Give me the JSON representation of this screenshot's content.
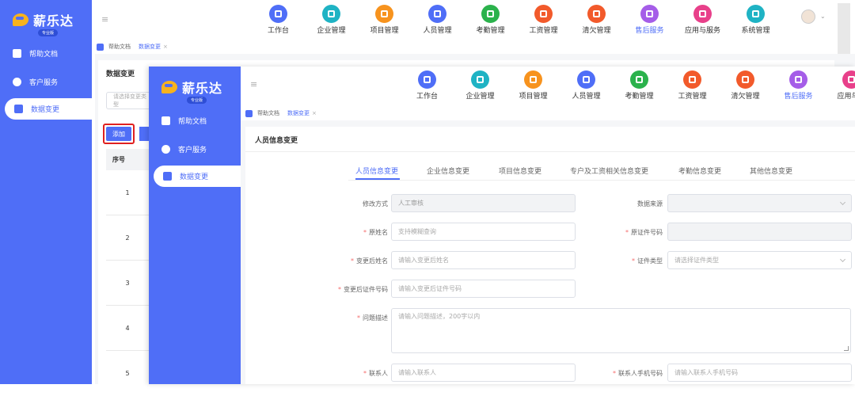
{
  "brand": {
    "name": "薪乐达",
    "edition": "专业版"
  },
  "nav": [
    "工作台",
    "企业管理",
    "项目管理",
    "人员管理",
    "考勤管理",
    "工资管理",
    "清欠管理",
    "售后服务",
    "应用与服务",
    "系统管理"
  ],
  "nav_colors": [
    "#4f6ef7",
    "#1fb3c4",
    "#f7931e",
    "#4f6ef7",
    "#2bb24c",
    "#f25a2b",
    "#f25a2b",
    "#a55de8",
    "#e8408a",
    "#1fb3c4"
  ],
  "nav_front": [
    "工作台",
    "企业管理",
    "项目管理",
    "人员管理",
    "考勤管理",
    "工资管理",
    "清欠管理",
    "售后服务",
    "应用与服"
  ],
  "sidebar": {
    "items": [
      "帮助文档",
      "客户服务",
      "数据变更"
    ]
  },
  "breadcrumb": {
    "items": [
      "帮助文档",
      "数据变更"
    ],
    "close": "×"
  },
  "back": {
    "title": "数据变更",
    "search_placeholder": "请选择变更类型",
    "add_label": "添加",
    "col_index": "序号",
    "rows": [
      "1",
      "2",
      "3",
      "4",
      "5"
    ]
  },
  "front": {
    "title": "人员信息变更",
    "tabs": [
      "人员信息变更",
      "企业信息变更",
      "项目信息变更",
      "专户及工资相关信息变更",
      "考勤信息变更",
      "其他信息变更"
    ],
    "form": {
      "method_label": "修改方式",
      "method_value": "人工审核",
      "source_label": "数据来源",
      "orig_name_label": "原姓名",
      "orig_name_ph": "支持模糊查询",
      "orig_id_label": "原证件号码",
      "new_name_label": "变更后姓名",
      "new_name_ph": "请输入变更后姓名",
      "id_type_label": "证件类型",
      "id_type_ph": "请选择证件类型",
      "new_id_label": "变更后证件号码",
      "new_id_ph": "请输入变更后证件号码",
      "desc_label": "问题描述",
      "desc_ph": "请输入问题描述，200字以内",
      "contact_label": "联系人",
      "contact_ph": "请输入联系人",
      "phone_label": "联系人手机号码",
      "phone_ph": "请输入联系人手机号码"
    }
  }
}
